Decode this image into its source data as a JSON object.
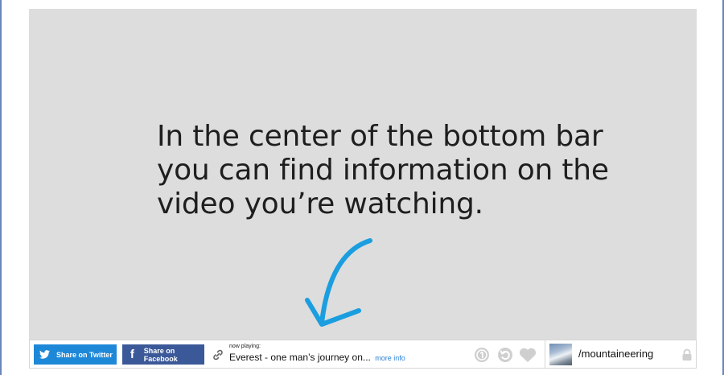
{
  "overlay": {
    "lines": [
      "In the center of the bottom bar",
      "you can find information on the",
      "video you’re watching."
    ]
  },
  "bottom_bar": {
    "twitter_label": "Share on Twitter",
    "facebook_label": "Share on Facebook",
    "now_playing_label": "now playing:",
    "video_title": "Everest - one man’s journey on...",
    "more_info": "more info",
    "channel_name": "/mountaineering"
  },
  "colors": {
    "stage_bg": "#dddddd",
    "arrow": "#1a9ee0",
    "twitter": "#1e88d8",
    "facebook": "#3b5998",
    "link": "#2a7fd4",
    "control_icons": "#cfcfcf"
  },
  "icons": [
    "twitter-bird-icon",
    "facebook-f-icon",
    "link-icon",
    "number-one-circle-icon",
    "replay-icon",
    "heart-icon",
    "lock-icon"
  ]
}
